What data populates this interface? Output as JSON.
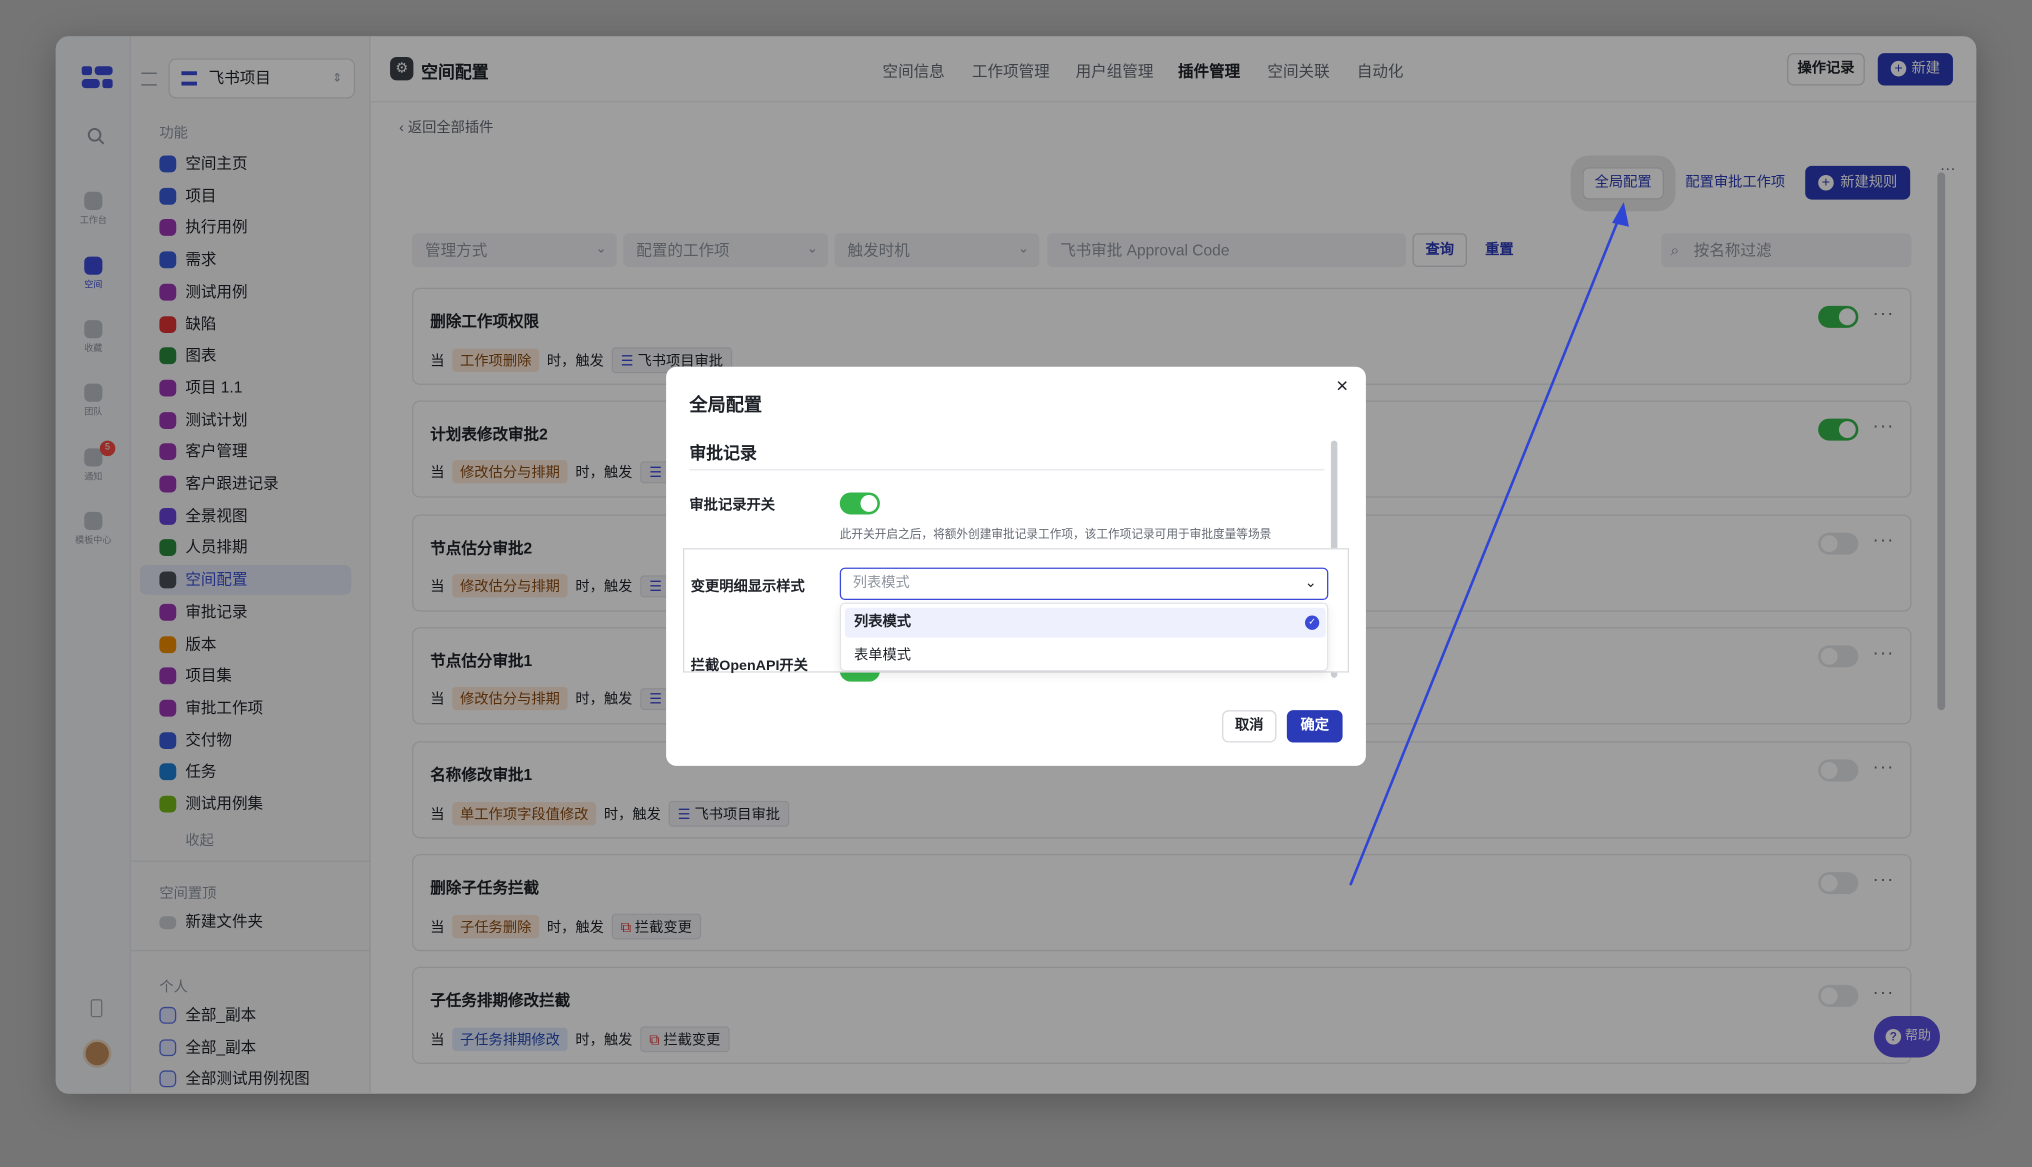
{
  "rail": {
    "items": [
      {
        "label": "工作台"
      },
      {
        "label": "空间"
      },
      {
        "label": "收藏"
      },
      {
        "label": "团队"
      },
      {
        "label": "通知",
        "badge": "5"
      },
      {
        "label": "模板中心"
      }
    ]
  },
  "sidebar": {
    "project": "飞书项目",
    "section_features": "功能",
    "items": [
      {
        "label": "空间主页",
        "color": "#3b5bdb"
      },
      {
        "label": "项目",
        "color": "#3b5bdb"
      },
      {
        "label": "执行用例",
        "color": "#9c36b5"
      },
      {
        "label": "需求",
        "color": "#3b5bdb"
      },
      {
        "label": "测试用例",
        "color": "#9c36b5"
      },
      {
        "label": "缺陷",
        "color": "#e03131"
      },
      {
        "label": "图表",
        "color": "#2b8a3e"
      },
      {
        "label": "项目 1.1",
        "color": "#9c36b5"
      },
      {
        "label": "测试计划",
        "color": "#9c36b5"
      },
      {
        "label": "客户管理",
        "color": "#9c36b5"
      },
      {
        "label": "客户跟进记录",
        "color": "#9c36b5"
      },
      {
        "label": "全景视图",
        "color": "#6741d9"
      },
      {
        "label": "人员排期",
        "color": "#2b8a3e"
      },
      {
        "label": "空间配置",
        "color": "#495057"
      },
      {
        "label": "审批记录",
        "color": "#9c36b5"
      },
      {
        "label": "版本",
        "color": "#f08c00"
      },
      {
        "label": "项目集",
        "color": "#9c36b5"
      },
      {
        "label": "审批工作项",
        "color": "#9c36b5"
      },
      {
        "label": "交付物",
        "color": "#3b5bdb"
      },
      {
        "label": "任务",
        "color": "#1c7ed6"
      },
      {
        "label": "测试用例集",
        "color": "#74b816"
      }
    ],
    "collapse": "收起",
    "section_pinned": "空间置顶",
    "new_folder": "新建文件夹",
    "section_personal": "个人",
    "personal_items": [
      "全部_副本",
      "全部_副本",
      "全部测试用例视图"
    ]
  },
  "header": {
    "title": "空间配置",
    "tabs": [
      "空间信息",
      "工作项管理",
      "用户组管理",
      "插件管理",
      "空间关联",
      "自动化"
    ],
    "active_tab": "插件管理",
    "log_button": "操作记录",
    "new_button": "新建"
  },
  "main": {
    "back_link": "返回全部插件",
    "global_config": "全局配置",
    "config_approval": "配置审批工作项",
    "new_rule": "新建规则",
    "filters": {
      "manage_mode": "管理方式",
      "work_item": "配置的工作项",
      "trigger": "触发时机",
      "approval_code": "飞书审批 Approval Code",
      "query": "查询",
      "reset": "重置",
      "search": "按名称过滤"
    },
    "row_prefix": "当",
    "row_mid": "时，触发",
    "rules": [
      {
        "title": "删除工作项权限",
        "event": "工作项删除",
        "event_style": "orange",
        "action": "飞书项目审批",
        "on": true
      },
      {
        "title": "计划表修改审批2",
        "event": "修改估分与排期",
        "event_style": "orange",
        "action": "",
        "on": true
      },
      {
        "title": "节点估分审批2",
        "event": "修改估分与排期",
        "event_style": "orange",
        "action": "",
        "on": false
      },
      {
        "title": "节点估分审批1",
        "event": "修改估分与排期",
        "event_style": "orange",
        "action": "",
        "on": false
      },
      {
        "title": "名称修改审批1",
        "event": "单工作项字段值修改",
        "event_style": "orange",
        "action": "飞书项目审批",
        "on": false
      },
      {
        "title": "删除子任务拦截",
        "event": "子任务删除",
        "event_style": "orange",
        "action": "拦截变更",
        "on": false
      },
      {
        "title": "子任务排期修改拦截",
        "event": "子任务排期修改",
        "event_style": "blue",
        "action": "拦截变更",
        "on": false
      }
    ],
    "help": "帮助"
  },
  "dialog": {
    "title": "全局配置",
    "section": "审批记录",
    "switch_label": "审批记录开关",
    "switch_on": true,
    "hint": "此开关开启之后，将额外创建审批记录工作项，该工作项记录可用于审批度量等场景",
    "style_label": "变更明细显示样式",
    "style_placeholder": "列表模式",
    "options": [
      "列表模式",
      "表单模式"
    ],
    "selected_option": "列表模式",
    "openapi_label": "拦截OpenAPI开关",
    "cancel": "取消",
    "confirm": "确定"
  },
  "colors": {
    "accent": "#2b3bb8",
    "toggle_on": "#35b64a",
    "annotation_arrow": "#2f45d6"
  }
}
